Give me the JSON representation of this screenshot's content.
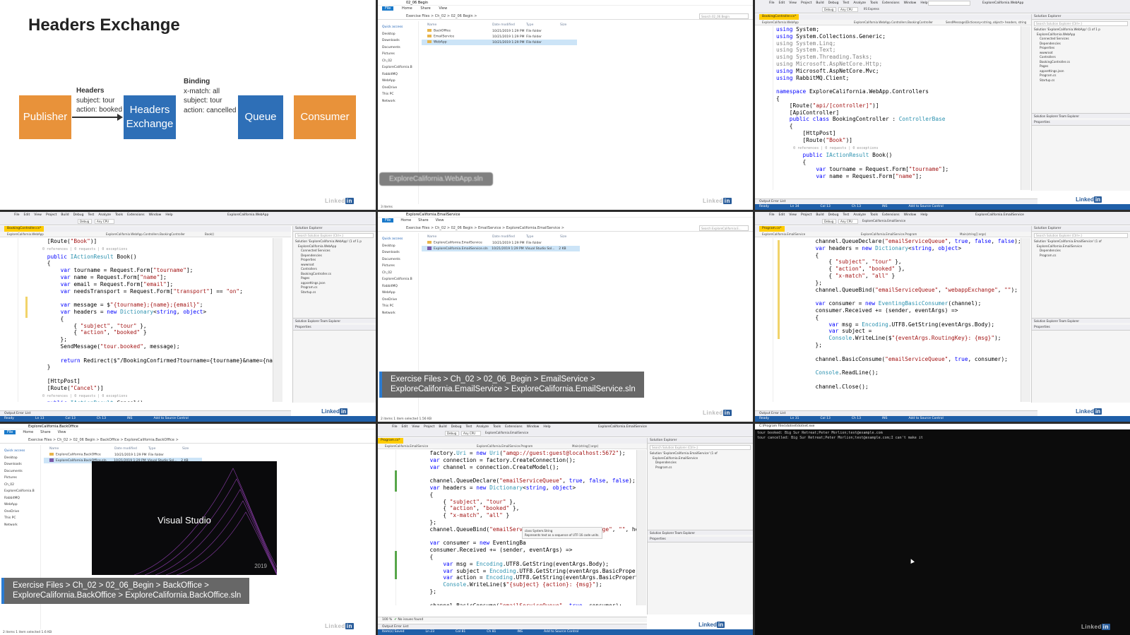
{
  "slide": {
    "title": "Headers Exchange",
    "publisher": "Publisher",
    "headers_exchange_1": "Headers",
    "headers_exchange_2": "Exchange",
    "queue": "Queue",
    "consumer": "Consumer",
    "msg_headers_title": "Headers",
    "msg_headers_1": "subject: tour",
    "msg_headers_2": "action: booked",
    "binding_title": "Binding",
    "binding_1": "x-match: all",
    "binding_2": "subject: tour",
    "binding_3": "action: cancelled"
  },
  "watermark": "Linked",
  "watermark_pill": "in",
  "watermark_sub": "LEARNING",
  "explorer1": {
    "title": "02_06 Begin",
    "ribbon": [
      "File",
      "Home",
      "Share",
      "View"
    ],
    "address": "Exercise Files  >  Ch_02  >  02_06 Begin  >",
    "search": "Search 02_06 Begin",
    "nav": [
      "Quick access",
      "Desktop",
      "Downloads",
      "Documents",
      "Pictures",
      "Ch_02",
      "ExploreCalifornia.B",
      "RabbitMQ",
      "WebApp",
      "OneDrive",
      "This PC",
      "Network"
    ],
    "cols": [
      "Name",
      "Date modified",
      "Type",
      "Size"
    ],
    "rows": [
      {
        "name": "BackOffice",
        "date": "10/21/2019 1:29 PM",
        "type": "File folder",
        "size": ""
      },
      {
        "name": "EmailService",
        "date": "10/21/2019 1:29 PM",
        "type": "File folder",
        "size": ""
      },
      {
        "name": "WebApp",
        "date": "10/21/2019 1:29 PM",
        "type": "File folder",
        "size": ""
      }
    ],
    "status": "3 items",
    "caption": "ExploreCalifornia.WebApp.sln"
  },
  "vs1": {
    "menu": [
      "File",
      "Edit",
      "View",
      "Project",
      "Build",
      "Debug",
      "Test",
      "Analyze",
      "Tools",
      "Extensions",
      "Window",
      "Help"
    ],
    "search": "Search (Ctrl+Q)",
    "solution": "ExploreCalifornia.WebApp",
    "config": "Debug",
    "platform": "Any CPU",
    "run": "IIS Express",
    "tab": "BookingController.cs*",
    "nav1": "ExploreCalifornia.WebApp",
    "nav2": "ExploreCalifornia.WebApp.Controllers.BookingController",
    "nav3": "SendMessage(Dictionary<string, object> headers, string",
    "code": [
      "using System;",
      "using System.Collections.Generic;",
      "using System.Linq;",
      "using System.Text;",
      "using System.Threading.Tasks;",
      "using Microsoft.AspNetCore.Http;",
      "using Microsoft.AspNetCore.Mvc;",
      "using RabbitMQ.Client;",
      "",
      "namespace ExploreCalifornia.WebApp.Controllers",
      "{",
      "    [Route(\"api/[controller]\")]",
      "    [ApiController]",
      "    public class BookingController : ControllerBase",
      "    {",
      "        [HttpPost]",
      "        [Route(\"Book\")]",
      "        0 references | 0 requests | 0 exceptions",
      "        public IActionResult Book()",
      "        {",
      "            var tourname = Request.Form[\"tourname\"];",
      "            var name = Request.Form[\"name\"];"
    ],
    "se_title": "Solution Explorer",
    "se_search": "Search Solution Explorer (Ctrl+;)",
    "se_items": [
      "Solution 'ExploreCalifornia.WebApp' (1 of 1 p",
      "ExploreCalifornia.WebApp",
      "Connected Services",
      "Dependencies",
      "Properties",
      "wwwroot",
      "Controllers",
      "BookingController.cs",
      "Pages",
      "appsettings.json",
      "Program.cs",
      "Startup.cs"
    ],
    "se_tabs": "Solution Explorer   Team Explorer",
    "prop": "Properties",
    "output": "Output   Error List",
    "status": [
      "Ready",
      "Ln 34",
      "Col 13",
      "Ch 13",
      "INS",
      "Add to Source Control"
    ],
    "zoom": "100 %"
  },
  "vs2": {
    "tab": "BookingController.cs*",
    "nav2": "ExploreCalifornia.WebApp.Controllers.BookingController",
    "nav3": "Book()",
    "code": [
      "    [Route(\"Book\")]",
      "    0 references | 0 requests | 0 exceptions",
      "    public IActionResult Book()",
      "    {",
      "        var tourname = Request.Form[\"tourname\"];",
      "        var name = Request.Form[\"name\"];",
      "        var email = Request.Form[\"email\"];",
      "        var needsTransport = Request.Form[\"transport\"] == \"on\";",
      "",
      "        var message = $\"{tourname};{name};{email}\";",
      "        var headers = new Dictionary<string, object>",
      "        {",
      "            { \"subject\", \"tour\" },",
      "            { \"action\", \"booked\" }",
      "        };",
      "        SendMessage(\"tour.booked\", message);",
      "",
      "        return Redirect($\"/BookingConfirmed?tourname={tourname}&name={name}&em",
      "    }",
      "",
      "    [HttpPost]",
      "    [Route(\"Cancel\")]",
      "    0 references | 0 requests | 0 exceptions",
      "    public IActionResult Cancel()"
    ],
    "status": [
      "Ready",
      "Ln 13",
      "Col 13",
      "Ch 13",
      "INS",
      "Add to Source Control"
    ]
  },
  "explorer2": {
    "title": "ExploreCalifornia.EmailService",
    "address": "Exercise Files  >  Ch_02  >  02_06 Begin  >  EmailService  >  ExploreCalifornia.EmailService  >",
    "search": "Search ExploreCalifornia.E...",
    "rows": [
      {
        "name": "ExploreCalifornia.EmailService",
        "date": "10/21/2019 1:29 PM",
        "type": "File folder",
        "size": ""
      },
      {
        "name": "ExploreCalifornia.EmailService.sln",
        "date": "10/21/2019 1:29 PM",
        "type": "Visual Studio Sol...",
        "size": "2 KB"
      }
    ],
    "status": "2 items   1 item selected   1.56 KB",
    "caption1": "Exercise Files > Ch_02 > 02_06_Begin > EmailService >",
    "caption2": "ExploreCalifornia.EmailService > ExploreCalifornia.EmailService.sln"
  },
  "vs3": {
    "solution": "ExploreCalifornia.EmailService",
    "run": "ExploreCalifornia.EmailService",
    "tab": "Program.cs*",
    "nav1": "ExploreCalifornia.EmailService",
    "nav2": "ExploreCalifornia.EmailService.Program",
    "nav3": "Main(string[] args)",
    "code": [
      "        channel.QueueDeclare(\"emailServiceQueue\", true, false, false);",
      "        var headers = new Dictionary<string, object>",
      "        {",
      "            { \"subject\", \"tour\" },",
      "            { \"action\", \"booked\" },",
      "            { \"x-match\", \"all\" }",
      "        };",
      "        channel.QueueBind(\"emailServiceQueue\", \"webappExchange\", \"\");",
      "",
      "        var consumer = new EventingBasicConsumer(channel);",
      "        consumer.Received += (sender, eventArgs) =>",
      "        {",
      "            var msg = Encoding.UTF8.GetString(eventArgs.Body);",
      "            var subject =",
      "            Console.WriteLine($\"{eventArgs.RoutingKey}: {msg}\");",
      "        };",
      "",
      "        channel.BasicConsume(\"emailServiceQueue\", true, consumer);",
      "",
      "        Console.ReadLine();",
      "",
      "        channel.Close();"
    ],
    "se_items": [
      "Solution 'ExploreCalifornia.EmailService' (1 of",
      "ExploreCalifornia.EmailService",
      "Dependencies",
      "Program.cs"
    ],
    "status": [
      "Ready",
      "Ln 31",
      "Col 13",
      "Ch 13",
      "INS",
      "Add to Source Control"
    ]
  },
  "explorer3": {
    "title": "ExploreCalifornia.BackOffice",
    "address": "Exercise Files  >  Ch_02  >  02_06 Begin  >  BackOffice  >  ExploreCalifornia.BackOffice  >",
    "rows": [
      {
        "name": "ExploreCalifornia.BackOffice",
        "date": "10/21/2019 1:29 PM",
        "type": "File folder",
        "size": ""
      },
      {
        "name": "ExploreCalifornia.BackOffice.sln",
        "date": "10/21/2019 1:29 PM",
        "type": "Visual Studio Sol...",
        "size": "2 KB"
      }
    ],
    "status": "2 items   1 item selected   1.6 KB",
    "splash": "Visual Studio",
    "splash_year": "2019",
    "caption1": "Exercise Files > Ch_02 > 02_06_Begin > BackOffice >",
    "caption2": "ExploreCalifornia.BackOffice > ExploreCalifornia.BackOffice.sln"
  },
  "vs4": {
    "code": [
      "        factory.Uri = new Uri(\"amqp://guest:guest@localhost:5672\");",
      "        var connection = factory.CreateConnection();",
      "        var channel = connection.CreateModel();",
      "",
      "        channel.QueueDeclare(\"emailServiceQueue\", true, false, false);",
      "        var headers = new Dictionary<string, object>",
      "        {",
      "            { \"subject\", \"tour\" },",
      "            { \"action\", \"booked\" },",
      "            { \"x-match\", \"all\" }",
      "        };",
      "        channel.QueueBind(\"emailServiceQueue\", \"webappExchange\", \"\", headers);",
      "",
      "        var consumer = new EventingBa",
      "        consumer.Received += (sender, eventArgs) =>",
      "        {",
      "            var msg = Encoding.UTF8.GetString(eventArgs.Body);",
      "            var subject = Encoding.UTF8.GetString(eventArgs.BasicProperties.He",
      "            var action = Encoding.UTF8.GetString(eventArgs.BasicProperties.He",
      "            Console.WriteLine($\"{subject} {action}: {msg}\");",
      "        };",
      "",
      "        channel.BasicConsume(\"emailServiceQueue\", true, consumer);"
    ],
    "tip1": "class System.String",
    "tip2": "Represents text as a sequence of UTF-16 code units.",
    "issues": "No issues found",
    "status": [
      "Item(s) Saved",
      "Ln 23",
      "Col 81",
      "Ch 81",
      "INS",
      "Add to Source Control"
    ]
  },
  "console": {
    "title": "C:\\Program Files\\dotnet\\dotnet.exe",
    "lines": [
      "tour booked: Big Sur Retreat;Peter Morlion;test@example.com",
      "tour cancelled: Big Sur Retreat;Peter Morlion;test@example.com;I can't make it"
    ]
  }
}
